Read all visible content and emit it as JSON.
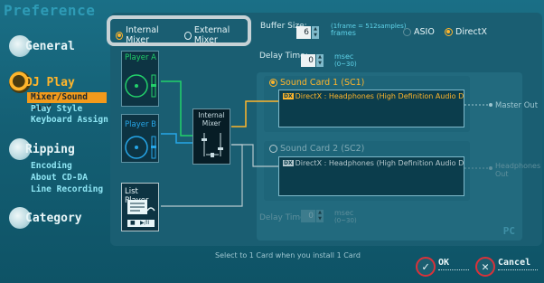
{
  "window": {
    "title": "Preference"
  },
  "sidebar": {
    "categories": [
      {
        "label": "General"
      },
      {
        "label": "DJ Play"
      },
      {
        "label": "Ripping"
      },
      {
        "label": "Category"
      }
    ],
    "dj_play_items": [
      "Mixer/Sound Card",
      "Play Style",
      "Keyboard Assign"
    ],
    "ripping_items": [
      "Encoding",
      "About CD-DA",
      "Line Recording"
    ]
  },
  "mixer_mode": {
    "internal_label": "Internal Mixer",
    "external_label": "External Mixer",
    "selected": "Internal Mixer"
  },
  "buffer": {
    "label": "Buffer Size:",
    "value": "6",
    "hint": "(1frame = 512samples)",
    "unit": "frames"
  },
  "driver": {
    "asio_label": "ASIO",
    "directx_label": "DirectX",
    "selected": "DirectX"
  },
  "delay_top": {
    "label": "Delay Time:",
    "value": "0",
    "unit": "msec",
    "range": "(0~30)"
  },
  "delay_bottom": {
    "label": "Delay Time:",
    "value": "0",
    "unit": "msec",
    "range": "(0~30)"
  },
  "players": {
    "a": "Player A",
    "b": "Player B",
    "list": "List Player",
    "list_buttons": [
      "■",
      "▶/II"
    ]
  },
  "internal_mixer": {
    "line1": "Internal",
    "line2": "Mixer"
  },
  "sound_card_1": {
    "label": "Sound Card 1 (SC1)",
    "badge": "DX",
    "device": "DirectX : Headphones (High Definition Audio D",
    "output": "Master Out"
  },
  "sound_card_2": {
    "label": "Sound Card 2 (SC2)",
    "badge": "DX",
    "device": "DirectX : Headphones (High Definition Audio D",
    "output_line1": "Headphones",
    "output_line2": "Out"
  },
  "pc_label": "PC",
  "footer": {
    "message": "Select to 1 Card when you install 1 Card",
    "ok_label": "OK",
    "cancel_label": "Cancel"
  },
  "colors": {
    "accent": "#ffb52b",
    "player_a": "#22d06a",
    "player_b": "#26a6e8",
    "button_ring": "#d9323a"
  }
}
